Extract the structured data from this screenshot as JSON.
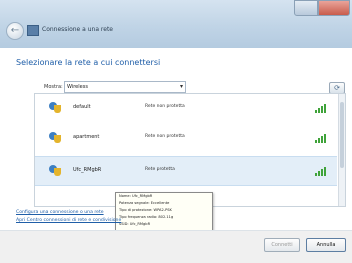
{
  "window": {
    "title": "Connessione a una rete",
    "back_symbol": "←"
  },
  "heading": "Selezionare la rete a cui connettersi",
  "filter": {
    "label": "Mostra:",
    "value": "Wireless"
  },
  "refresh_symbol": "⟳",
  "networks": [
    {
      "name": "default",
      "status": "Rete non protetta"
    },
    {
      "name": "apartment",
      "status": "Rete non protetta"
    },
    {
      "name": "Ufc_RMgbR",
      "status": "Rete protetta"
    }
  ],
  "tooltip": {
    "lines": [
      "Nome: Ufc_RMgbR",
      "Potenza segnale: Eccellente",
      "Tipo di protezione: WPA2-PSK",
      "Tipo frequenza radio: 802.11g",
      "SSID: Ufc_RMgbR"
    ]
  },
  "links": {
    "setup": "Configura una connessione o una rete",
    "network_center": "Apri Centro connessioni di rete e condivisione"
  },
  "buttons": {
    "connect": "Connetti",
    "cancel": "Annulla"
  },
  "colors": {
    "title_bar": "#c0d4e6",
    "accent_text": "#1f5ea8",
    "selection": "#e3eef8",
    "signal": "#3fa33a"
  },
  "icons": {
    "network": "network-shield-icon",
    "signal": "signal-strength-icon",
    "refresh": "refresh-icon",
    "back": "back-arrow-icon"
  }
}
